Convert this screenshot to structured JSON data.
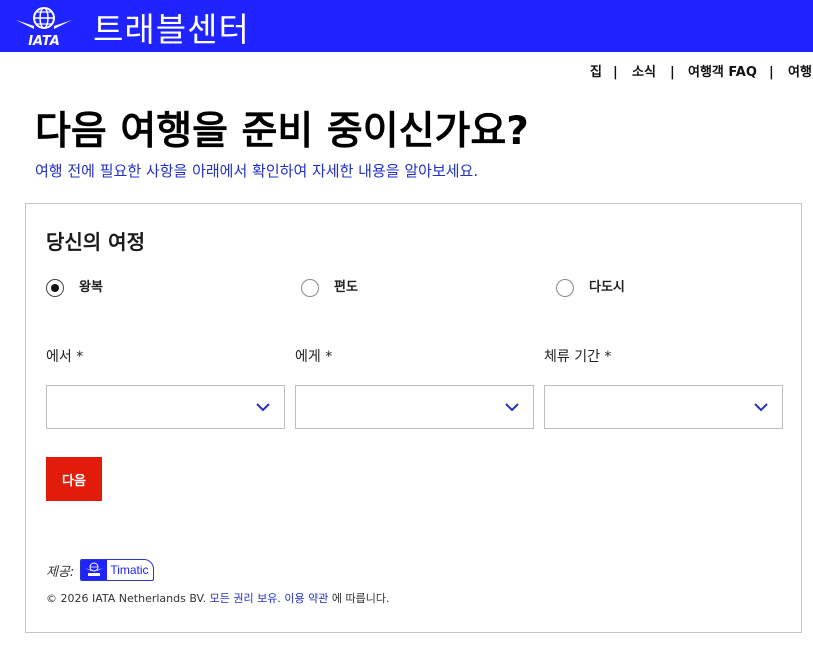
{
  "header": {
    "logo_text": "IATA",
    "brand": "트래블센터",
    "bg_color": "#1e23ff"
  },
  "topnav": {
    "items": [
      "집",
      "소식",
      "여행객 FAQ",
      "여행"
    ],
    "separator": "|"
  },
  "hero": {
    "title": "다음 여행을 준비 중이신가요?",
    "subtitle": "여행 전에 필요한 사항을 아래에서 확인하여 자세한 내용을 알아보세요."
  },
  "itinerary": {
    "title": "당신의 여정",
    "trip_types": [
      {
        "label": "왕복",
        "checked": true
      },
      {
        "label": "편도",
        "checked": false
      },
      {
        "label": "다도시",
        "checked": false
      }
    ],
    "fields": [
      {
        "label": "에서 *",
        "value": ""
      },
      {
        "label": "에게 *",
        "value": ""
      },
      {
        "label": "체류 기간 *",
        "value": ""
      }
    ],
    "next_label": "다음",
    "next_color": "#e11c0a"
  },
  "provided": {
    "label": "제공:",
    "badge_text": "Timatic"
  },
  "footer": {
    "copyright": "© 2026 IATA Netherlands BV. 모든 권리 보유. 이용 약관 에 따릅니다.",
    "prefix": "© 2026 IATA Netherlands BV.",
    "rights_link": "모든 권리 보유.",
    "terms_link": "이용 약관",
    "suffix": "에 따릅니다."
  },
  "icons": {
    "logo": "iata-globe-logo-icon",
    "chevron": "chevron-down-icon"
  }
}
